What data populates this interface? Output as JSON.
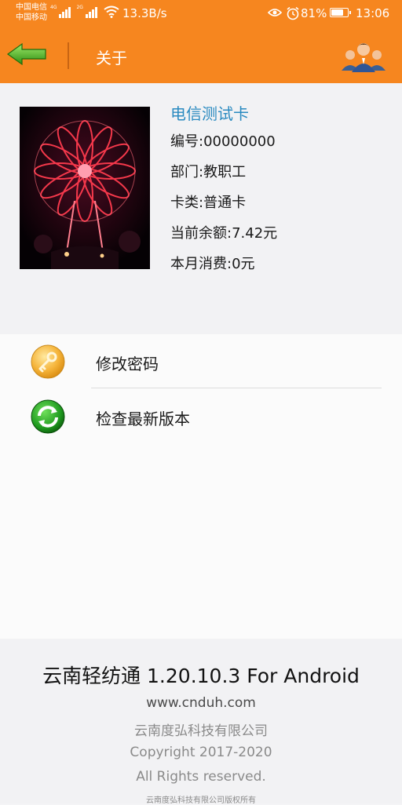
{
  "status_bar": {
    "carrier_1": "中国电信",
    "carrier_2": "中国移动",
    "net_1": "4G",
    "net_2": "2G",
    "speed": "13.3B/s",
    "battery": "81%",
    "battery_level": 0.81,
    "time": "13:06"
  },
  "header": {
    "title": "关于",
    "back_icon": "back-arrow-icon",
    "users_icon": "users-group-icon",
    "color": "#f6861f"
  },
  "profile": {
    "card_name": "电信测试卡",
    "rows": [
      "编号:00000000",
      "部门:教职工",
      "卡类:普通卡",
      "当前余额:7.42元",
      "本月消费:0元"
    ]
  },
  "menu": {
    "items": [
      {
        "label": "修改密码",
        "icon": "key-icon"
      },
      {
        "label": "检查最新版本",
        "icon": "refresh-icon"
      }
    ]
  },
  "footer": {
    "app_name": "云南轻纺通 1.20.10.3 For Android",
    "website": "www.cnduh.com",
    "company": "云南度弘科技有限公司",
    "copyright": "Copyright 2017-2020",
    "rights": "All Rights reserved.",
    "small_note": "云南度弘科技有限公司版权所有"
  }
}
